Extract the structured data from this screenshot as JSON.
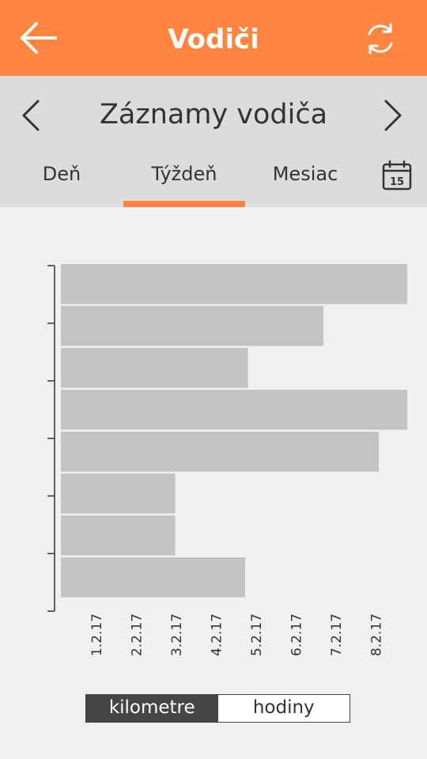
{
  "appbar": {
    "title": "Vodiči"
  },
  "header": {
    "subtitle": "Záznamy vodiča",
    "tabs": [
      {
        "label": "Deň",
        "active": false
      },
      {
        "label": "Týždeň",
        "active": true
      },
      {
        "label": "Mesiac",
        "active": false
      }
    ],
    "calendar_day": "15"
  },
  "colors": {
    "accent": "#ff8540",
    "bar": "#c3c3c3"
  },
  "chart_data": {
    "type": "bar",
    "orientation": "horizontal",
    "values": [
      100,
      75.8,
      54,
      100,
      91.8,
      33,
      33,
      53.2
    ],
    "xlim": [
      0,
      100
    ],
    "x_tick_labels": [
      "1.2.17",
      "2.2.17",
      "3.2.17",
      "4.2.17",
      "5.2.17",
      "6.2.17",
      "7.2.17",
      "8.2.17"
    ],
    "y_ticks": 7,
    "grid": false
  },
  "toggle": {
    "options": [
      "kilometre",
      "hodiny"
    ],
    "selected": "kilometre"
  }
}
